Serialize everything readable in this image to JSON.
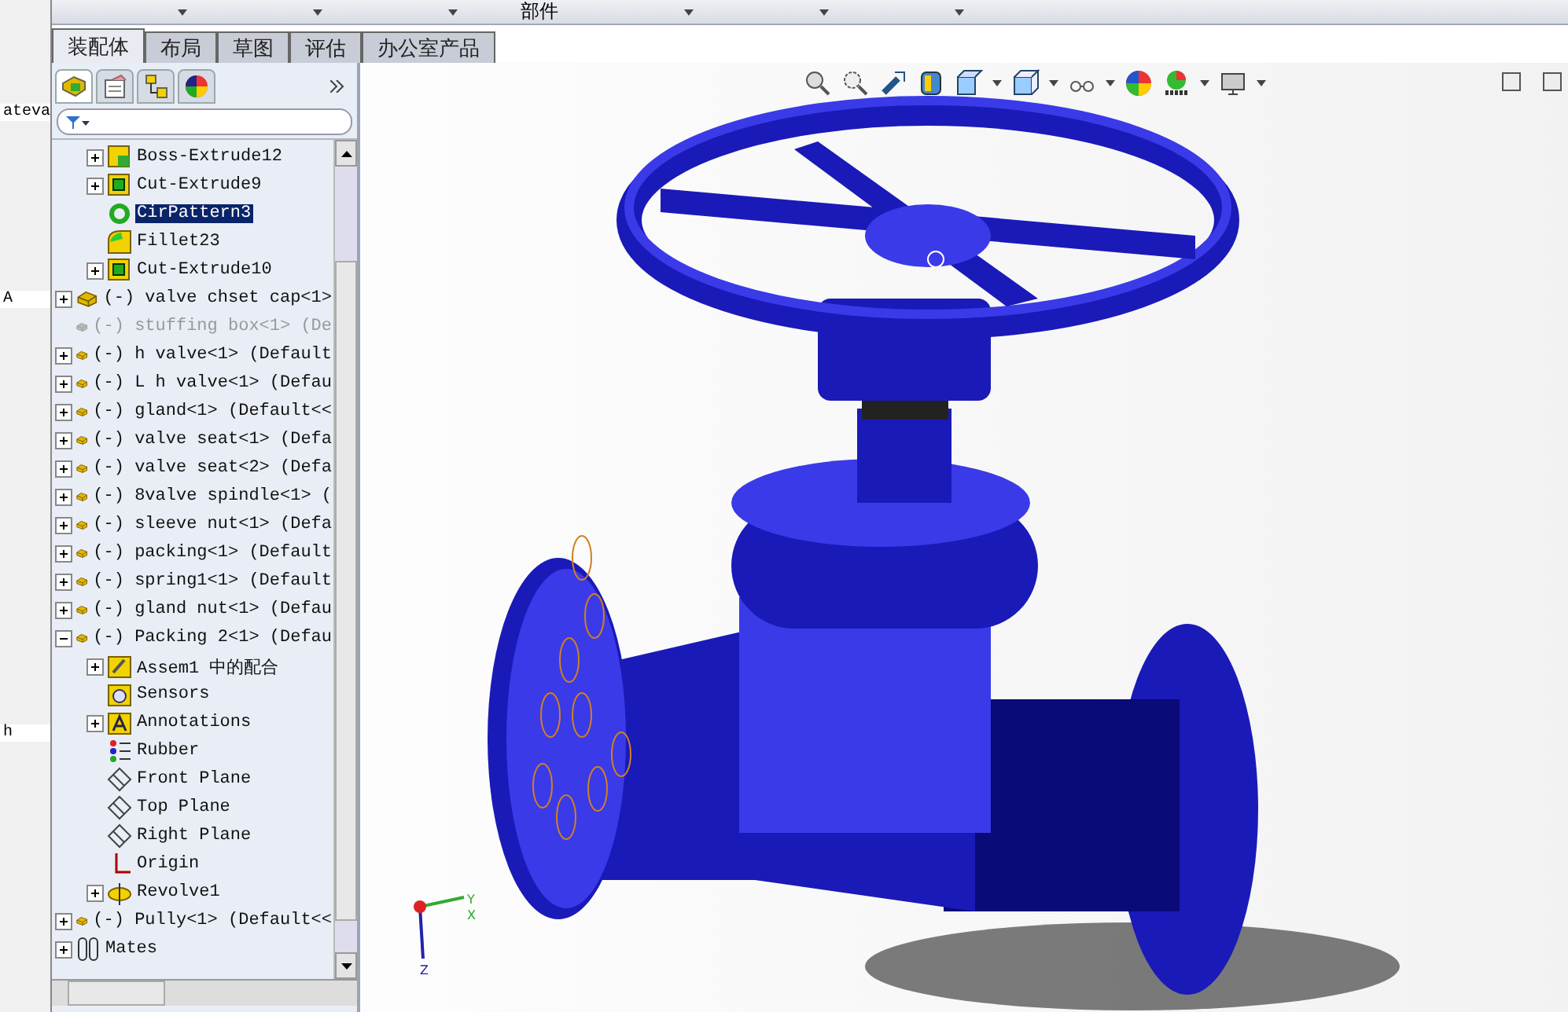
{
  "background_window": {
    "texts": [
      "ateva",
      "A",
      "h"
    ]
  },
  "top_menu": {
    "label": "部件"
  },
  "tabs": [
    {
      "label": "装配体",
      "selected": true
    },
    {
      "label": "布局",
      "selected": false
    },
    {
      "label": "草图",
      "selected": false
    },
    {
      "label": "评估",
      "selected": false
    },
    {
      "label": "办公室产品",
      "selected": false
    }
  ],
  "panel_tabs": [
    {
      "kind": "tree",
      "selected": true
    },
    {
      "kind": "property",
      "selected": false
    },
    {
      "kind": "config",
      "selected": false
    },
    {
      "kind": "display",
      "selected": false
    }
  ],
  "feature_tree": {
    "scrolled_parent_children": [
      {
        "label": "Boss-Extrude12",
        "kind": "boss",
        "expanded": false,
        "selected": false
      },
      {
        "label": "Cut-Extrude9",
        "kind": "cut",
        "expanded": false,
        "selected": false
      },
      {
        "label": "CirPattern3",
        "kind": "pattern",
        "selected": true
      },
      {
        "label": "Fillet23",
        "kind": "fillet",
        "selected": false
      },
      {
        "label": "Cut-Extrude10",
        "kind": "cut",
        "expanded": false,
        "selected": false
      }
    ],
    "items": [
      {
        "label": "(-) valve chset cap<1>",
        "kind": "part",
        "expanded": false,
        "selected": false,
        "suppressed": false
      },
      {
        "label": "(-) stuffing box<1> (De",
        "kind": "part",
        "selected": false,
        "suppressed": true
      },
      {
        "label": "(-) h valve<1> (Default",
        "kind": "part",
        "expanded": false,
        "selected": false,
        "suppressed": false
      },
      {
        "label": "(-) L h valve<1> (Defau",
        "kind": "part",
        "expanded": false,
        "selected": false,
        "suppressed": false
      },
      {
        "label": "(-) gland<1> (Default<<",
        "kind": "part",
        "expanded": false,
        "selected": false,
        "suppressed": false
      },
      {
        "label": "(-) valve seat<1> (Defa",
        "kind": "part",
        "expanded": false,
        "selected": false,
        "suppressed": false
      },
      {
        "label": "(-) valve seat<2> (Defa",
        "kind": "part",
        "expanded": false,
        "selected": false,
        "suppressed": false
      },
      {
        "label": "(-) 8valve spindle<1> (",
        "kind": "part",
        "expanded": false,
        "selected": false,
        "suppressed": false
      },
      {
        "label": "(-) sleeve nut<1> (Defa",
        "kind": "part",
        "expanded": false,
        "selected": false,
        "suppressed": false
      },
      {
        "label": "(-) packing<1> (Default",
        "kind": "part",
        "expanded": false,
        "selected": false,
        "suppressed": false
      },
      {
        "label": "(-) spring1<1> (Default",
        "kind": "part",
        "expanded": false,
        "selected": false,
        "suppressed": false
      },
      {
        "label": "(-) gland nut<1> (Defau",
        "kind": "part",
        "expanded": false,
        "selected": false,
        "suppressed": false
      },
      {
        "label": "(-) Packing 2<1> (Defau",
        "kind": "part",
        "expanded": true,
        "selected": false,
        "suppressed": false,
        "children": [
          {
            "label": "Assem1 中的配合",
            "kind": "mates-folder",
            "expanded": false,
            "selected": false
          },
          {
            "label": "Sensors",
            "kind": "sensor",
            "selected": false
          },
          {
            "label": "Annotations",
            "kind": "annotation",
            "expanded": false,
            "selected": false
          },
          {
            "label": "Rubber",
            "kind": "material",
            "selected": false
          },
          {
            "label": "Front Plane",
            "kind": "plane",
            "selected": false
          },
          {
            "label": "Top Plane",
            "kind": "plane",
            "selected": false
          },
          {
            "label": "Right Plane",
            "kind": "plane",
            "selected": false
          },
          {
            "label": "Origin",
            "kind": "origin",
            "selected": false
          },
          {
            "label": "Revolve1",
            "kind": "revolve",
            "expanded": false,
            "selected": false
          }
        ]
      },
      {
        "label": "(-) Pully<1> (Default<<",
        "kind": "part",
        "expanded": false,
        "selected": false,
        "suppressed": false
      },
      {
        "label": "Mates",
        "kind": "mates",
        "expanded": false,
        "selected": false,
        "suppressed": false
      }
    ]
  },
  "triad": {
    "axes": [
      "Y",
      "X",
      "Z"
    ]
  }
}
